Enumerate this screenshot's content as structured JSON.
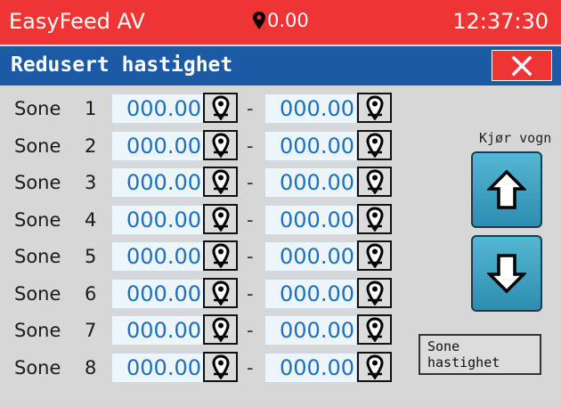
{
  "statusbar": {
    "app_name": "EasyFeed AV",
    "position": "0.00",
    "clock": "12:37:30"
  },
  "titlebar": {
    "title": "Redusert hastighet",
    "close_icon": "x-icon"
  },
  "zones": [
    {
      "label": "Sone",
      "number": "1",
      "start": "000.00",
      "end": "000.00"
    },
    {
      "label": "Sone",
      "number": "2",
      "start": "000.00",
      "end": "000.00"
    },
    {
      "label": "Sone",
      "number": "3",
      "start": "000.00",
      "end": "000.00"
    },
    {
      "label": "Sone",
      "number": "4",
      "start": "000.00",
      "end": "000.00"
    },
    {
      "label": "Sone",
      "number": "5",
      "start": "000.00",
      "end": "000.00"
    },
    {
      "label": "Sone",
      "number": "6",
      "start": "000.00",
      "end": "000.00"
    },
    {
      "label": "Sone",
      "number": "7",
      "start": "000.00",
      "end": "000.00"
    },
    {
      "label": "Sone",
      "number": "8",
      "start": "000.00",
      "end": "000.00"
    }
  ],
  "separator": "-",
  "pin_icon": "location-pin-icon",
  "drive": {
    "label": "Kjør vogn",
    "up_icon": "arrow-up-icon",
    "down_icon": "arrow-down-icon"
  },
  "zone_speed_button": {
    "line1": "Sone",
    "line2": "hastighet"
  },
  "colors": {
    "statusbar": "#ee3434",
    "titlebar": "#1c5aa6",
    "background": "#d7d7d7",
    "field_text": "#1d6fc0",
    "arrow_button": "#3ea3c4"
  }
}
